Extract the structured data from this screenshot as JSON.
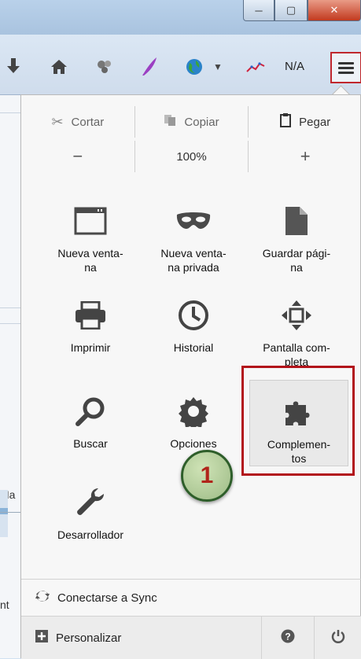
{
  "window": {
    "minimize": "─",
    "maximize": "▢",
    "close": "✕"
  },
  "toolbar": {
    "na_label": "N/A",
    "icons": [
      "download-icon",
      "home-icon",
      "puzzle-addon-icon",
      "quill-icon",
      "globe-icon",
      "dropdown-icon",
      "chart-icon"
    ]
  },
  "edit_row": {
    "cut": "Cortar",
    "copy": "Copiar",
    "paste": "Pegar"
  },
  "zoom_row": {
    "minus": "−",
    "level": "100%",
    "plus": "+"
  },
  "tiles": [
    {
      "label": "Nueva venta-\nna",
      "icon": "window-icon"
    },
    {
      "label": "Nueva venta-\nna privada",
      "icon": "mask-icon"
    },
    {
      "label": "Guardar pági-\nna",
      "icon": "page-icon"
    },
    {
      "label": "Imprimir",
      "icon": "printer-icon"
    },
    {
      "label": "Historial",
      "icon": "clock-icon"
    },
    {
      "label": "Pantalla com-\npleta",
      "icon": "fullscreen-icon"
    },
    {
      "label": "Buscar",
      "icon": "search-icon"
    },
    {
      "label": "Opciones",
      "icon": "gear-icon"
    },
    {
      "label": "Complemen-\ntos",
      "icon": "puzzle-icon"
    },
    {
      "label": "Desarrollador",
      "icon": "wrench-icon"
    }
  ],
  "badge": "1",
  "sync": "Conectarse a Sync",
  "customize": "Personalizar",
  "bg_fragments": {
    "a": "Ma",
    "b": "nt"
  },
  "colors": {
    "highlight": "#b2121a",
    "badge_border": "#2e5e2a"
  }
}
